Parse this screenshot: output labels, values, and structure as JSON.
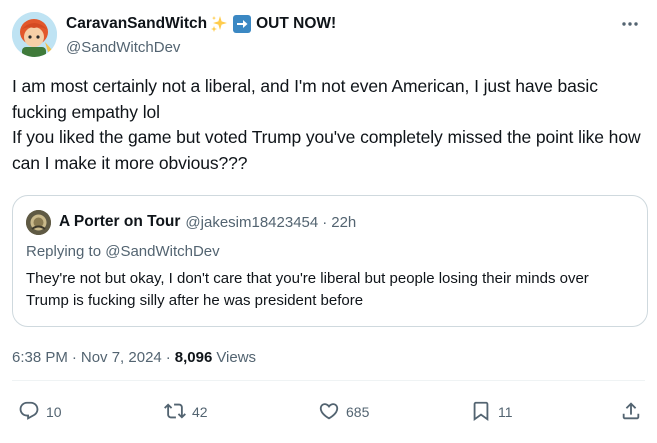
{
  "author": {
    "display_name": "CaravanSandWitch",
    "emoji_sparkles": "✨",
    "emoji_arrow": "➡",
    "name_suffix": "OUT NOW!",
    "handle": "@SandWitchDev"
  },
  "post": {
    "text": "I am most certainly not a liberal, and I'm not even American, I just have basic fucking empathy lol\nIf you liked the game but voted Trump you've completely missed the point like how can I make it more obvious???"
  },
  "quote": {
    "name": "A Porter on Tour",
    "handle": "@jakesim18423454",
    "dot": "·",
    "time": "22h",
    "replying_prefix": "Replying to ",
    "replying_handle": "@SandWitchDev",
    "text": "They're not but okay, I don't care that you're liberal but people losing their minds over Trump is fucking silly after he was president before"
  },
  "meta": {
    "time": "6:38 PM",
    "sep": "·",
    "date": "Nov 7, 2024",
    "views_count": "8,096",
    "views_label": "Views"
  },
  "actions": {
    "replies": "10",
    "reposts": "42",
    "likes": "685",
    "bookmarks": "11"
  },
  "icons": {
    "reply": "reply-icon",
    "repost": "repost-icon",
    "like": "heart-icon",
    "bookmark": "bookmark-icon",
    "share": "share-icon",
    "more": "more-icon"
  },
  "colors": {
    "text": "#0f1419",
    "secondary": "#536471",
    "border": "#cfd9de",
    "divider": "#eff3f4",
    "arrow_emoji_bg": "#3b88c3"
  }
}
